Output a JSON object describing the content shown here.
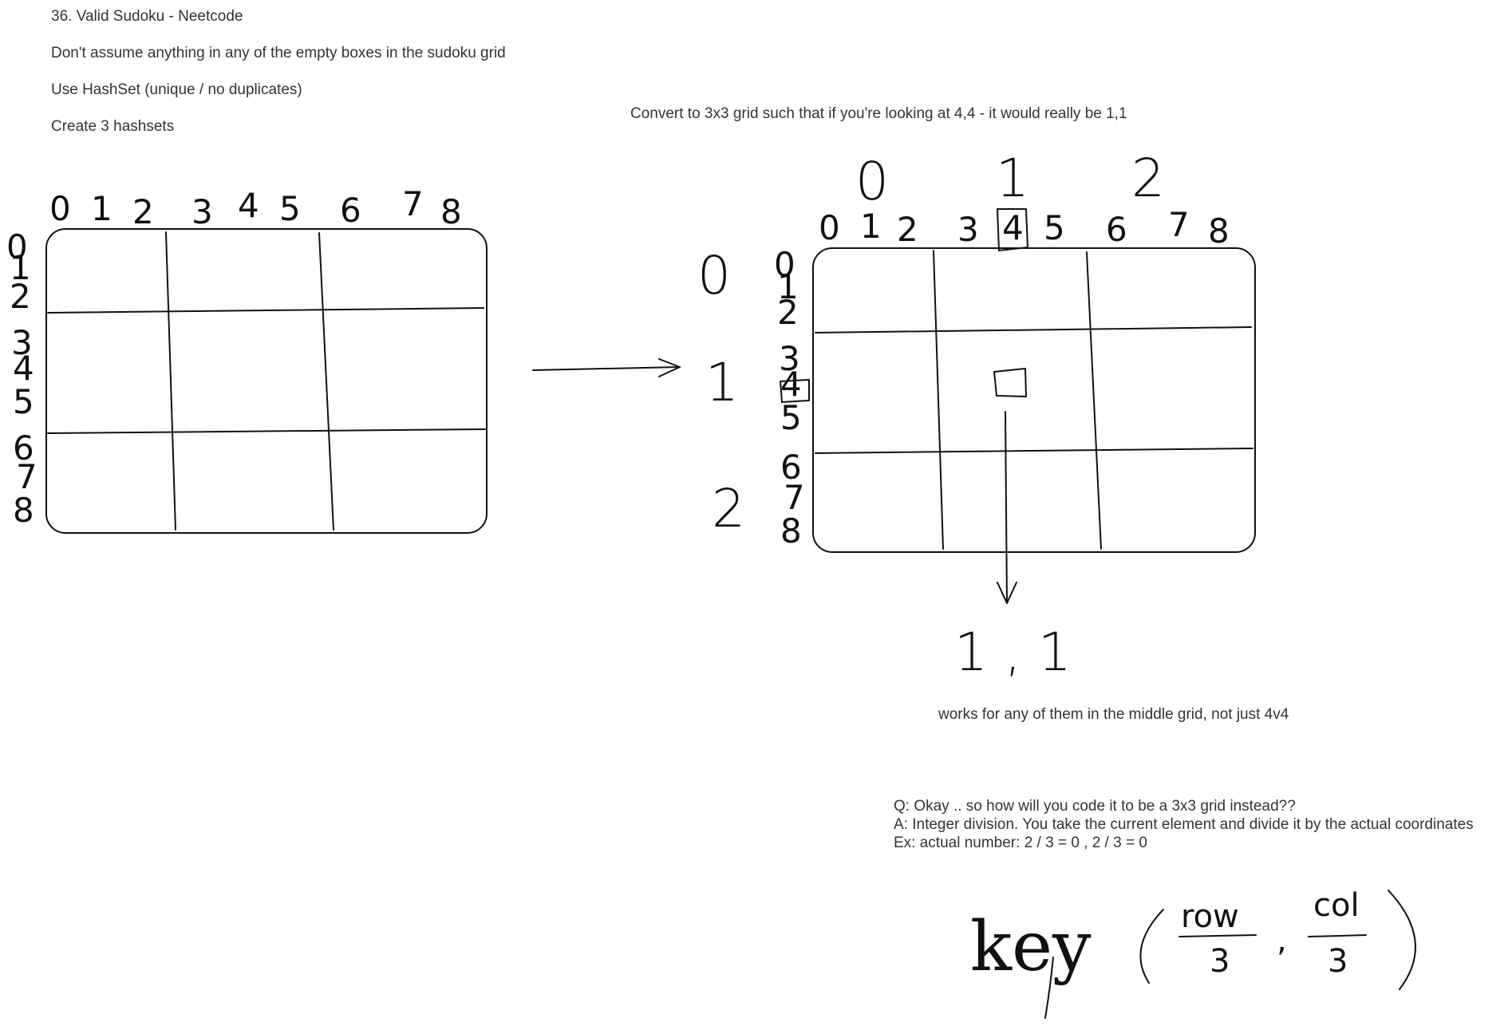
{
  "notes": {
    "title": "36. Valid Sudoku - Neetcode",
    "line1": "Don't assume anything in any of the empty boxes in the sudoku grid",
    "line2": "Use HashSet (unique / no duplicates)",
    "line3": "Create 3 hashsets",
    "convert": "Convert to 3x3 grid such that if you're looking at 4,4 - it would really be 1,1",
    "middle": "works for any of them in the middle grid, not just 4v4"
  },
  "qa": {
    "q": "Q: Okay .. so how will you code it to be a 3x3 grid instead??",
    "a": "A: Integer division. You take the current element and divide it by the actual coordinates",
    "ex": "Ex: actual number: 2 / 3 = 0 , 2 / 3 = 0"
  },
  "handwriting": {
    "left_col_labels": [
      "0",
      "1",
      "2",
      "3",
      "4",
      "5",
      "6",
      "7",
      "8"
    ],
    "left_row_labels": [
      "0",
      "1",
      "2",
      "3",
      "4",
      "5",
      "6",
      "7",
      "8"
    ],
    "right_col_labels": [
      "0",
      "1",
      "2",
      "3",
      "4",
      "5",
      "6",
      "7",
      "8"
    ],
    "right_row_labels": [
      "0",
      "1",
      "2",
      "3",
      "4",
      "5",
      "6",
      "7",
      "8"
    ],
    "box_col_labels": [
      "0",
      "1",
      "2"
    ],
    "box_row_labels": [
      "0",
      "1",
      "2"
    ],
    "result": "1 , 1",
    "key_word": "key",
    "key_row": "row",
    "key_col": "col",
    "key_div": "3",
    "key_comma": ","
  }
}
